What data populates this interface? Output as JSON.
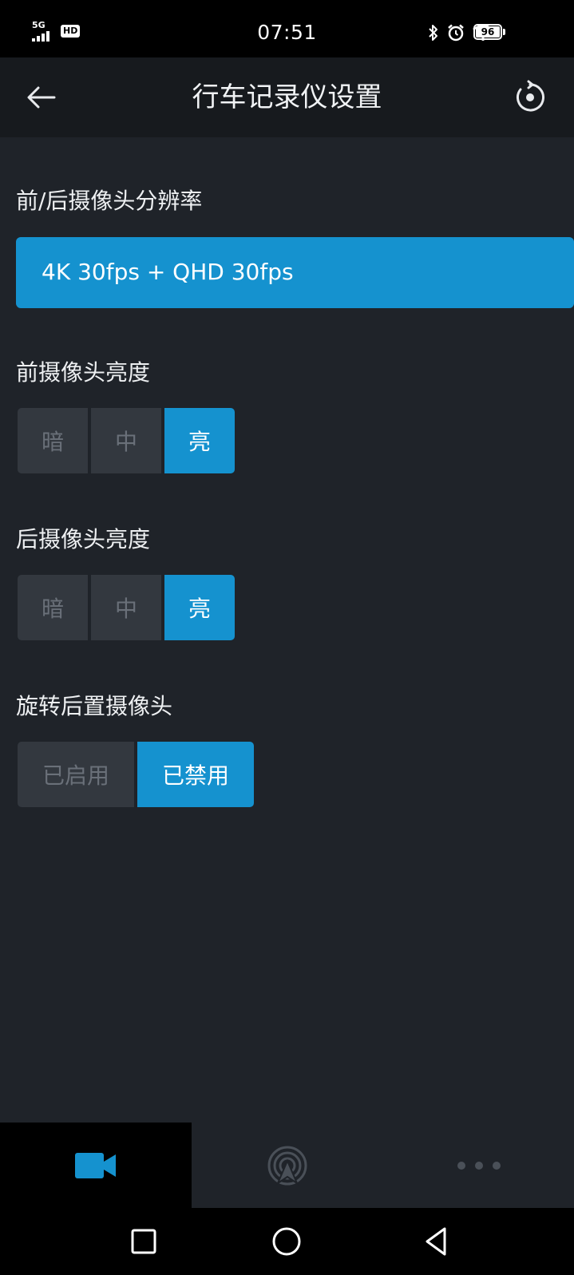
{
  "status_bar": {
    "network": "5G",
    "hd_badge": "HD",
    "time": "07:51",
    "battery_level": "96",
    "icons": [
      "bluetooth-icon",
      "alarm-icon",
      "wifi-icon",
      "battery-icon"
    ]
  },
  "header": {
    "title": "行车记录仪设置",
    "back_icon": "arrow-left-icon",
    "reset_icon": "reset-icon"
  },
  "settings": {
    "resolution": {
      "label": "前/后摄像头分辨率",
      "value": "4K 30fps + QHD 30fps"
    },
    "front_brightness": {
      "label": "前摄像头亮度",
      "options": [
        "暗",
        "中",
        "亮"
      ],
      "selected": "亮"
    },
    "rear_brightness": {
      "label": "后摄像头亮度",
      "options": [
        "暗",
        "中",
        "亮"
      ],
      "selected": "亮"
    },
    "rotate_rear": {
      "label": "旋转后置摄像头",
      "options": [
        "已启用",
        "已禁用"
      ],
      "selected": "已禁用"
    }
  },
  "bottom_nav": {
    "tabs": [
      {
        "icon": "video-camera-icon",
        "active": true
      },
      {
        "icon": "broadcast-location-icon",
        "active": false
      },
      {
        "icon": "more-dots-icon",
        "active": false
      }
    ]
  },
  "system_nav": {
    "buttons": [
      "recent-apps-icon",
      "home-icon",
      "back-triangle-icon"
    ]
  },
  "colors": {
    "accent": "#1592cf",
    "background": "#1f2329",
    "header": "#171a1e",
    "inactive_option": "#33383f"
  }
}
